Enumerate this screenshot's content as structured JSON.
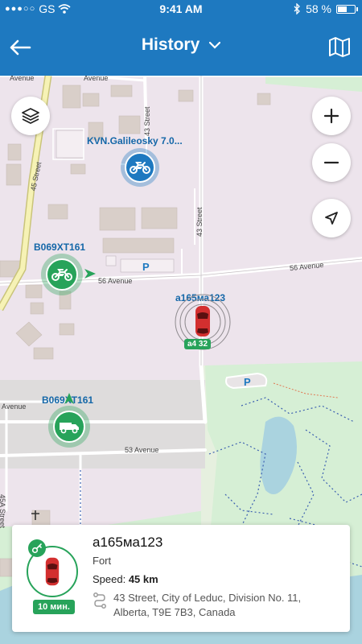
{
  "status_bar": {
    "signal": "●●●○○",
    "carrier": "GS",
    "time": "9:41 AM",
    "battery_percent": "58 %",
    "battery_level": 0.58
  },
  "header": {
    "title": "History",
    "back_icon": "arrow-left-icon",
    "title_icon": "chevron-down-icon",
    "map_icon": "map-icon"
  },
  "map": {
    "streets": {
      "s45": "45 Street",
      "s43": "43 Street",
      "s43b": "43 Street",
      "a56": "56 Avenue",
      "a56b": "56 Avenue",
      "a53": "53 Avenue",
      "avenue_left": "Avenue",
      "street_45a": "45A Street",
      "avenue_top": "Avenue",
      "avenue_top2": "Avenue"
    },
    "parking_label": "P",
    "controls": {
      "layers": "layers-icon",
      "zoom_in": "+",
      "zoom_out": "−",
      "locate": "navigation-arrow-icon"
    },
    "vehicles": [
      {
        "label": "KVN.Galileosky 7.0...",
        "icon": "motorcycle-icon",
        "color": "#1e79c0"
      },
      {
        "label": "B069XT161",
        "icon": "motorcycle-icon",
        "color": "#27a35a"
      },
      {
        "label": "a165ма123",
        "icon": "car-icon",
        "color": "#d32f2f",
        "plate": "a4 32"
      },
      {
        "label": "B069XT161",
        "icon": "truck-icon",
        "color": "#27a35a"
      }
    ]
  },
  "card": {
    "name": "a165ма123",
    "group": "Fort",
    "speed_label": "Speed:",
    "speed_value": "45 km",
    "time_badge": "10 мин.",
    "address": "43 Street, City of Leduc, Division No. 11, Alberta, T9E 7B3, Canada",
    "key_icon": "key-icon",
    "route_icon": "route-icon",
    "vehicle_icon": "car-icon"
  },
  "colors": {
    "header": "#1e79c0",
    "green": "#27a35a",
    "blue": "#1e79c0",
    "residential": "#ede4ec",
    "park": "#d6efd5",
    "water": "#aad3df"
  }
}
